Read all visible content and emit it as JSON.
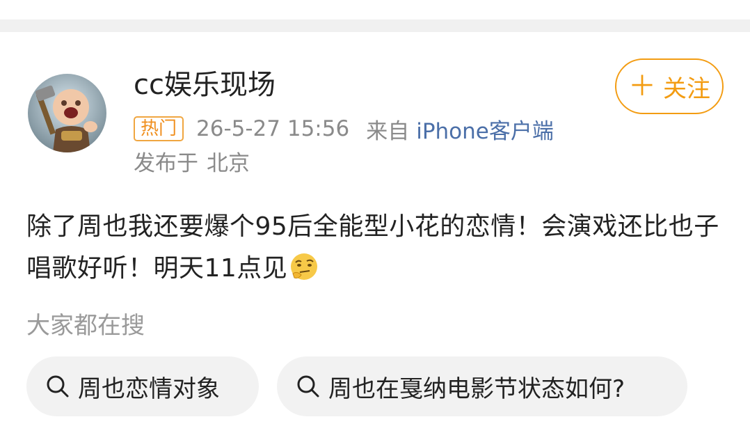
{
  "header": {
    "username": "cc娱乐现场",
    "follow_label": "关注",
    "hot_badge": "热门",
    "timestamp": "26-5-27 15:56",
    "from_label": "来自",
    "source": "iPhone客户端",
    "location_label": "发布于",
    "location": "北京"
  },
  "content": {
    "text": "除了周也我还要爆个95后全能型小花的恋情！会演戏还比也子唱歌好听！明天11点见"
  },
  "search": {
    "title": "大家都在搜",
    "chips": [
      {
        "label": "周也恋情对象"
      },
      {
        "label": "周也在戛纳电影节状态如何?"
      }
    ]
  },
  "colors": {
    "accent": "#f39c12",
    "link": "#4b6fa8",
    "meta": "#8a8a8a"
  }
}
